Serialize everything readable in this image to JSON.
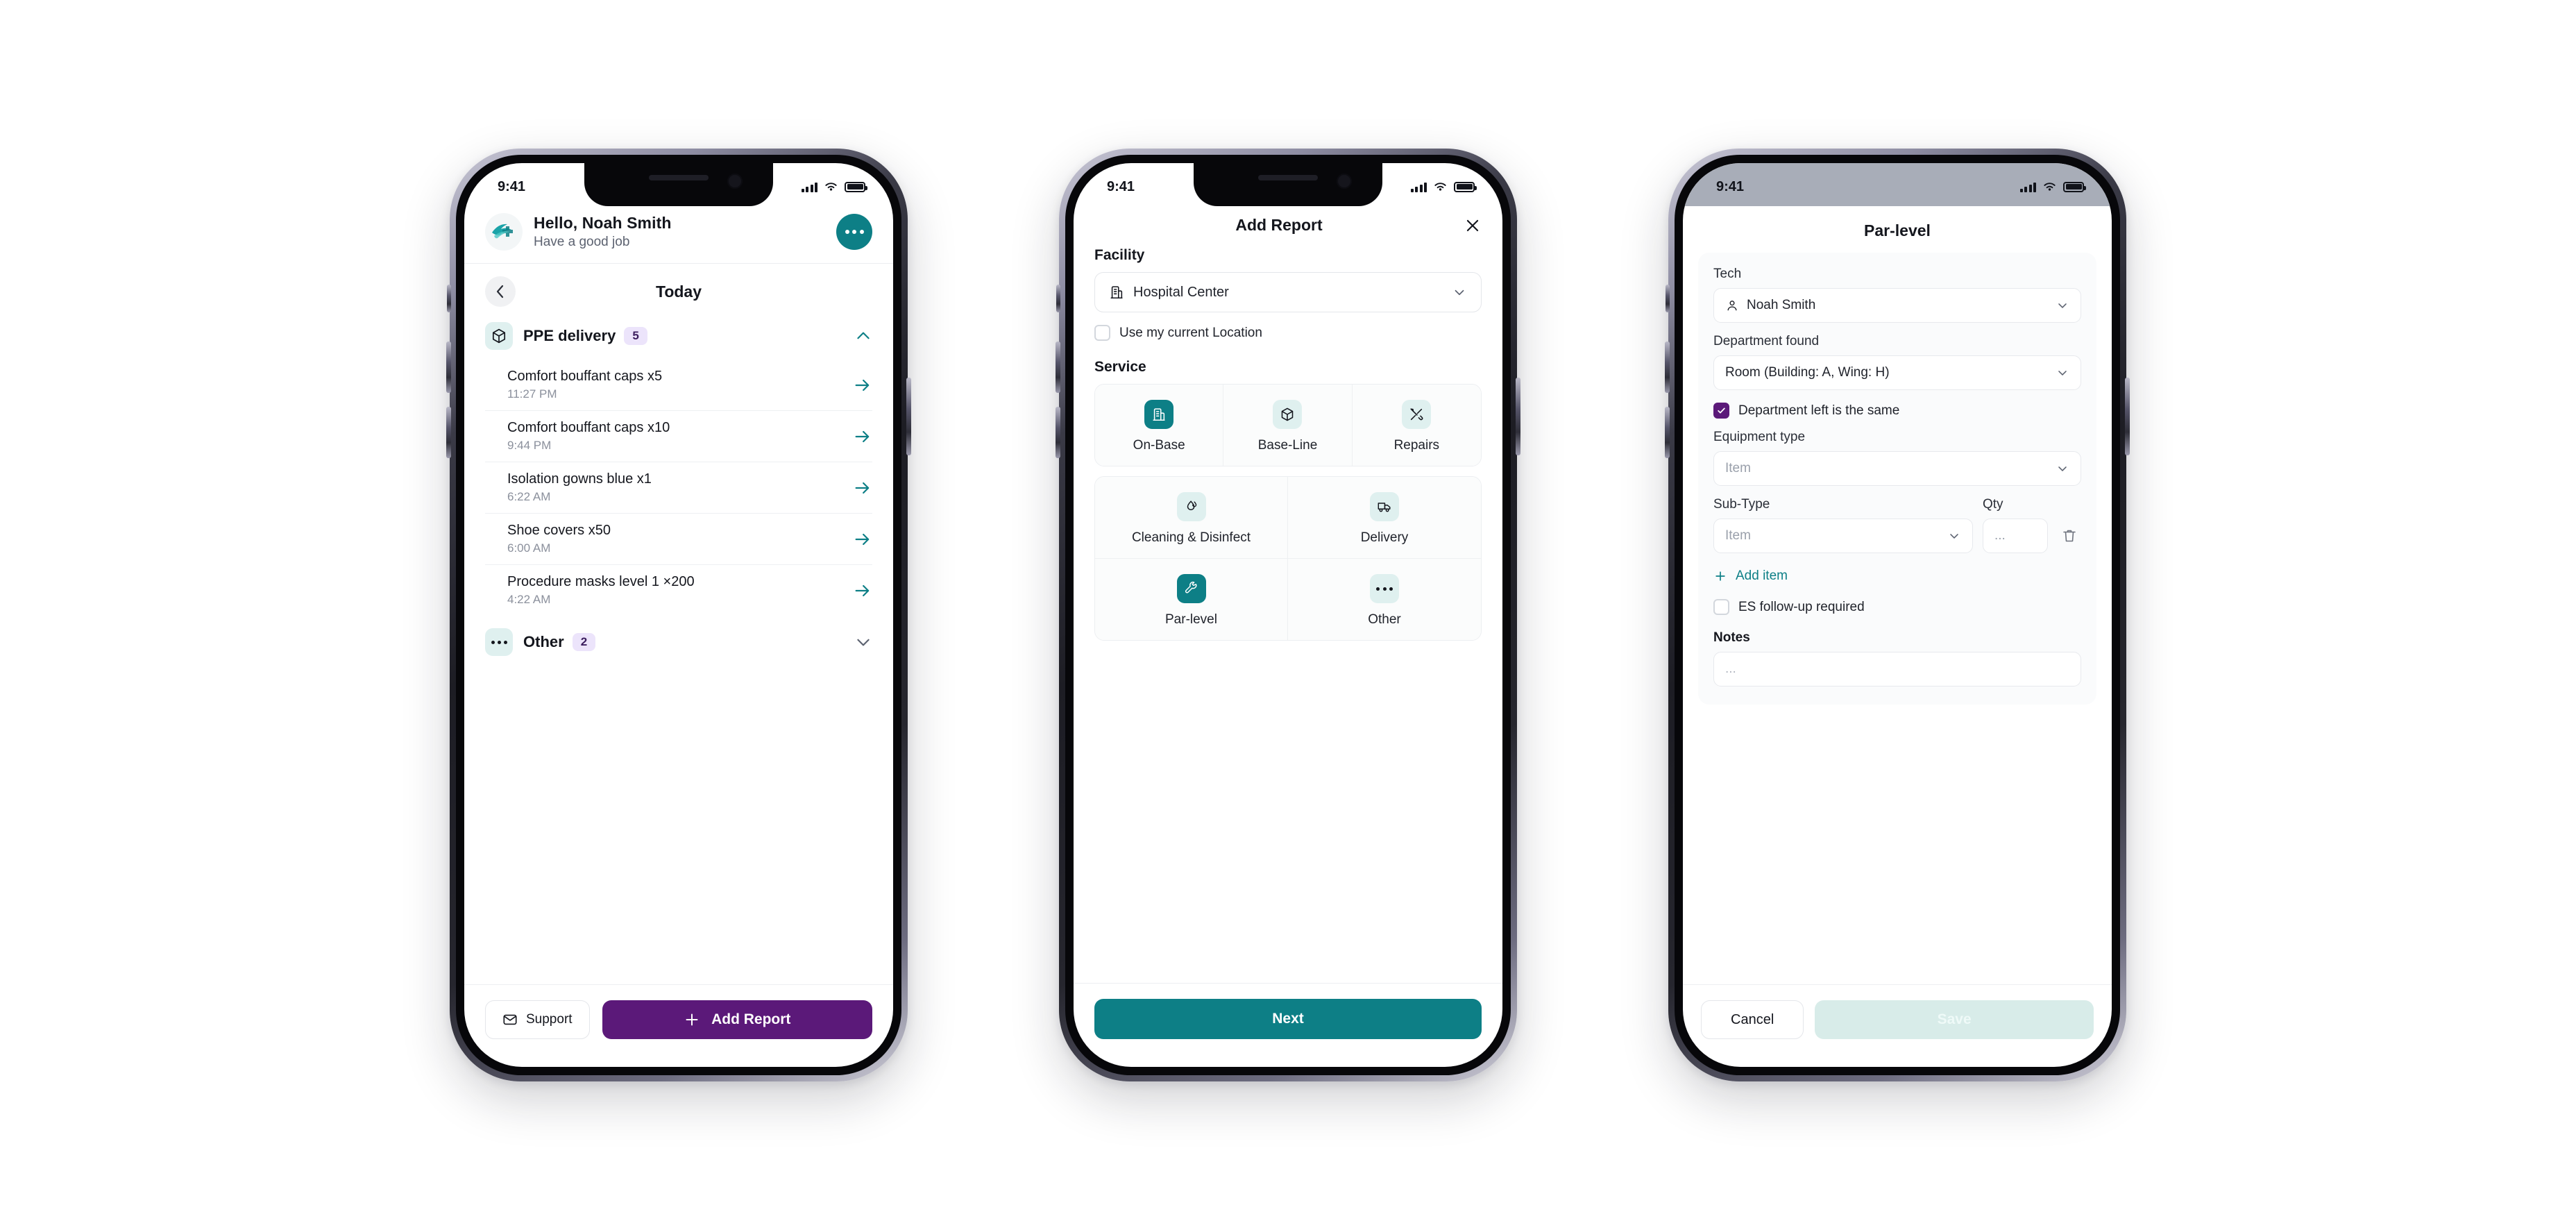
{
  "colors": {
    "teal": "#0d7f86",
    "teal_soft": "#dff0ef",
    "purple": "#5b1979",
    "badge_bg": "#ece4fb",
    "badge_text": "#3b1d5e",
    "save_disabled_bg": "#d8ece9"
  },
  "status_bar": {
    "time": "9:41",
    "signal_icon": "cellular-signal-icon",
    "wifi_icon": "wifi-icon",
    "battery_icon": "battery-icon"
  },
  "phone1": {
    "header": {
      "logo_icon": "app-logo-icon",
      "greeting": "Hello, Noah Smith",
      "subtitle": "Have a good job",
      "menu_icon": "more-options-icon"
    },
    "day_nav": {
      "back_icon": "chevron-left-icon",
      "title": "Today"
    },
    "groups": [
      {
        "icon": "package-icon",
        "name": "PPE delivery",
        "count": "5",
        "expanded": true,
        "chevron_icon": "chevron-up-icon",
        "tasks": [
          {
            "title": "Comfort bouffant caps x5",
            "time": "11:27 PM",
            "arrow_icon": "arrow-right-icon"
          },
          {
            "title": "Comfort bouffant caps x10",
            "time": "9:44 PM",
            "arrow_icon": "arrow-right-icon"
          },
          {
            "title": "Isolation gowns blue x1",
            "time": "6:22 AM",
            "arrow_icon": "arrow-right-icon"
          },
          {
            "title": "Shoe covers x50",
            "time": "6:00 AM",
            "arrow_icon": "arrow-right-icon"
          },
          {
            "title": "Procedure masks level 1 ×200",
            "time": "4:22 AM",
            "arrow_icon": "arrow-right-icon"
          }
        ]
      },
      {
        "icon": "ellipsis-icon",
        "name": "Other",
        "count": "2",
        "expanded": false,
        "chevron_icon": "chevron-down-icon",
        "tasks": []
      }
    ],
    "footer": {
      "support_label": "Support",
      "support_icon": "envelope-icon",
      "add_report_label": "Add Report",
      "add_report_icon": "plus-icon"
    }
  },
  "phone2": {
    "title": "Add Report",
    "close_icon": "close-icon",
    "facility": {
      "label": "Facility",
      "value": "Hospital Center",
      "icon": "building-icon",
      "chevron_icon": "chevron-down-icon"
    },
    "use_location": {
      "label": "Use my current Location",
      "checked": false
    },
    "service": {
      "label": "Service",
      "row1": [
        {
          "name": "On-Base",
          "icon": "building-icon",
          "selected": true
        },
        {
          "name": "Base-Line",
          "icon": "package-icon",
          "selected": false
        },
        {
          "name": "Repairs",
          "icon": "tools-icon",
          "selected": false
        }
      ],
      "row2": [
        {
          "name": "Cleaning & Disinfect",
          "icon": "droplet-icon",
          "selected": false
        },
        {
          "name": "Delivery",
          "icon": "truck-icon",
          "selected": false
        },
        {
          "name": "Par-level",
          "icon": "wrench-icon",
          "selected": true
        },
        {
          "name": "Other",
          "icon": "ellipsis-icon",
          "selected": false
        }
      ]
    },
    "next_label": "Next"
  },
  "phone3": {
    "title": "Par-level",
    "tech": {
      "label": "Tech",
      "value": "Noah Smith",
      "icon": "user-icon",
      "chevron_icon": "chevron-down-icon"
    },
    "department_found": {
      "label": "Department found",
      "value": "Room (Building: A, Wing: H)",
      "chevron_icon": "chevron-down-icon"
    },
    "department_same": {
      "label": "Department left is the same",
      "checked": true
    },
    "equipment_type": {
      "label": "Equipment type",
      "placeholder": "Item",
      "chevron_icon": "chevron-down-icon"
    },
    "sub_type": {
      "label": "Sub-Type",
      "placeholder": "Item",
      "chevron_icon": "chevron-down-icon"
    },
    "qty": {
      "label": "Qty",
      "placeholder": "..."
    },
    "delete_icon": "trash-icon",
    "add_item": {
      "label": "Add item",
      "icon": "plus-icon"
    },
    "es_followup": {
      "label": "ES follow-up required",
      "checked": false
    },
    "notes": {
      "label": "Notes",
      "placeholder": "..."
    },
    "footer": {
      "cancel_label": "Cancel",
      "save_label": "Save",
      "save_disabled": true
    }
  }
}
